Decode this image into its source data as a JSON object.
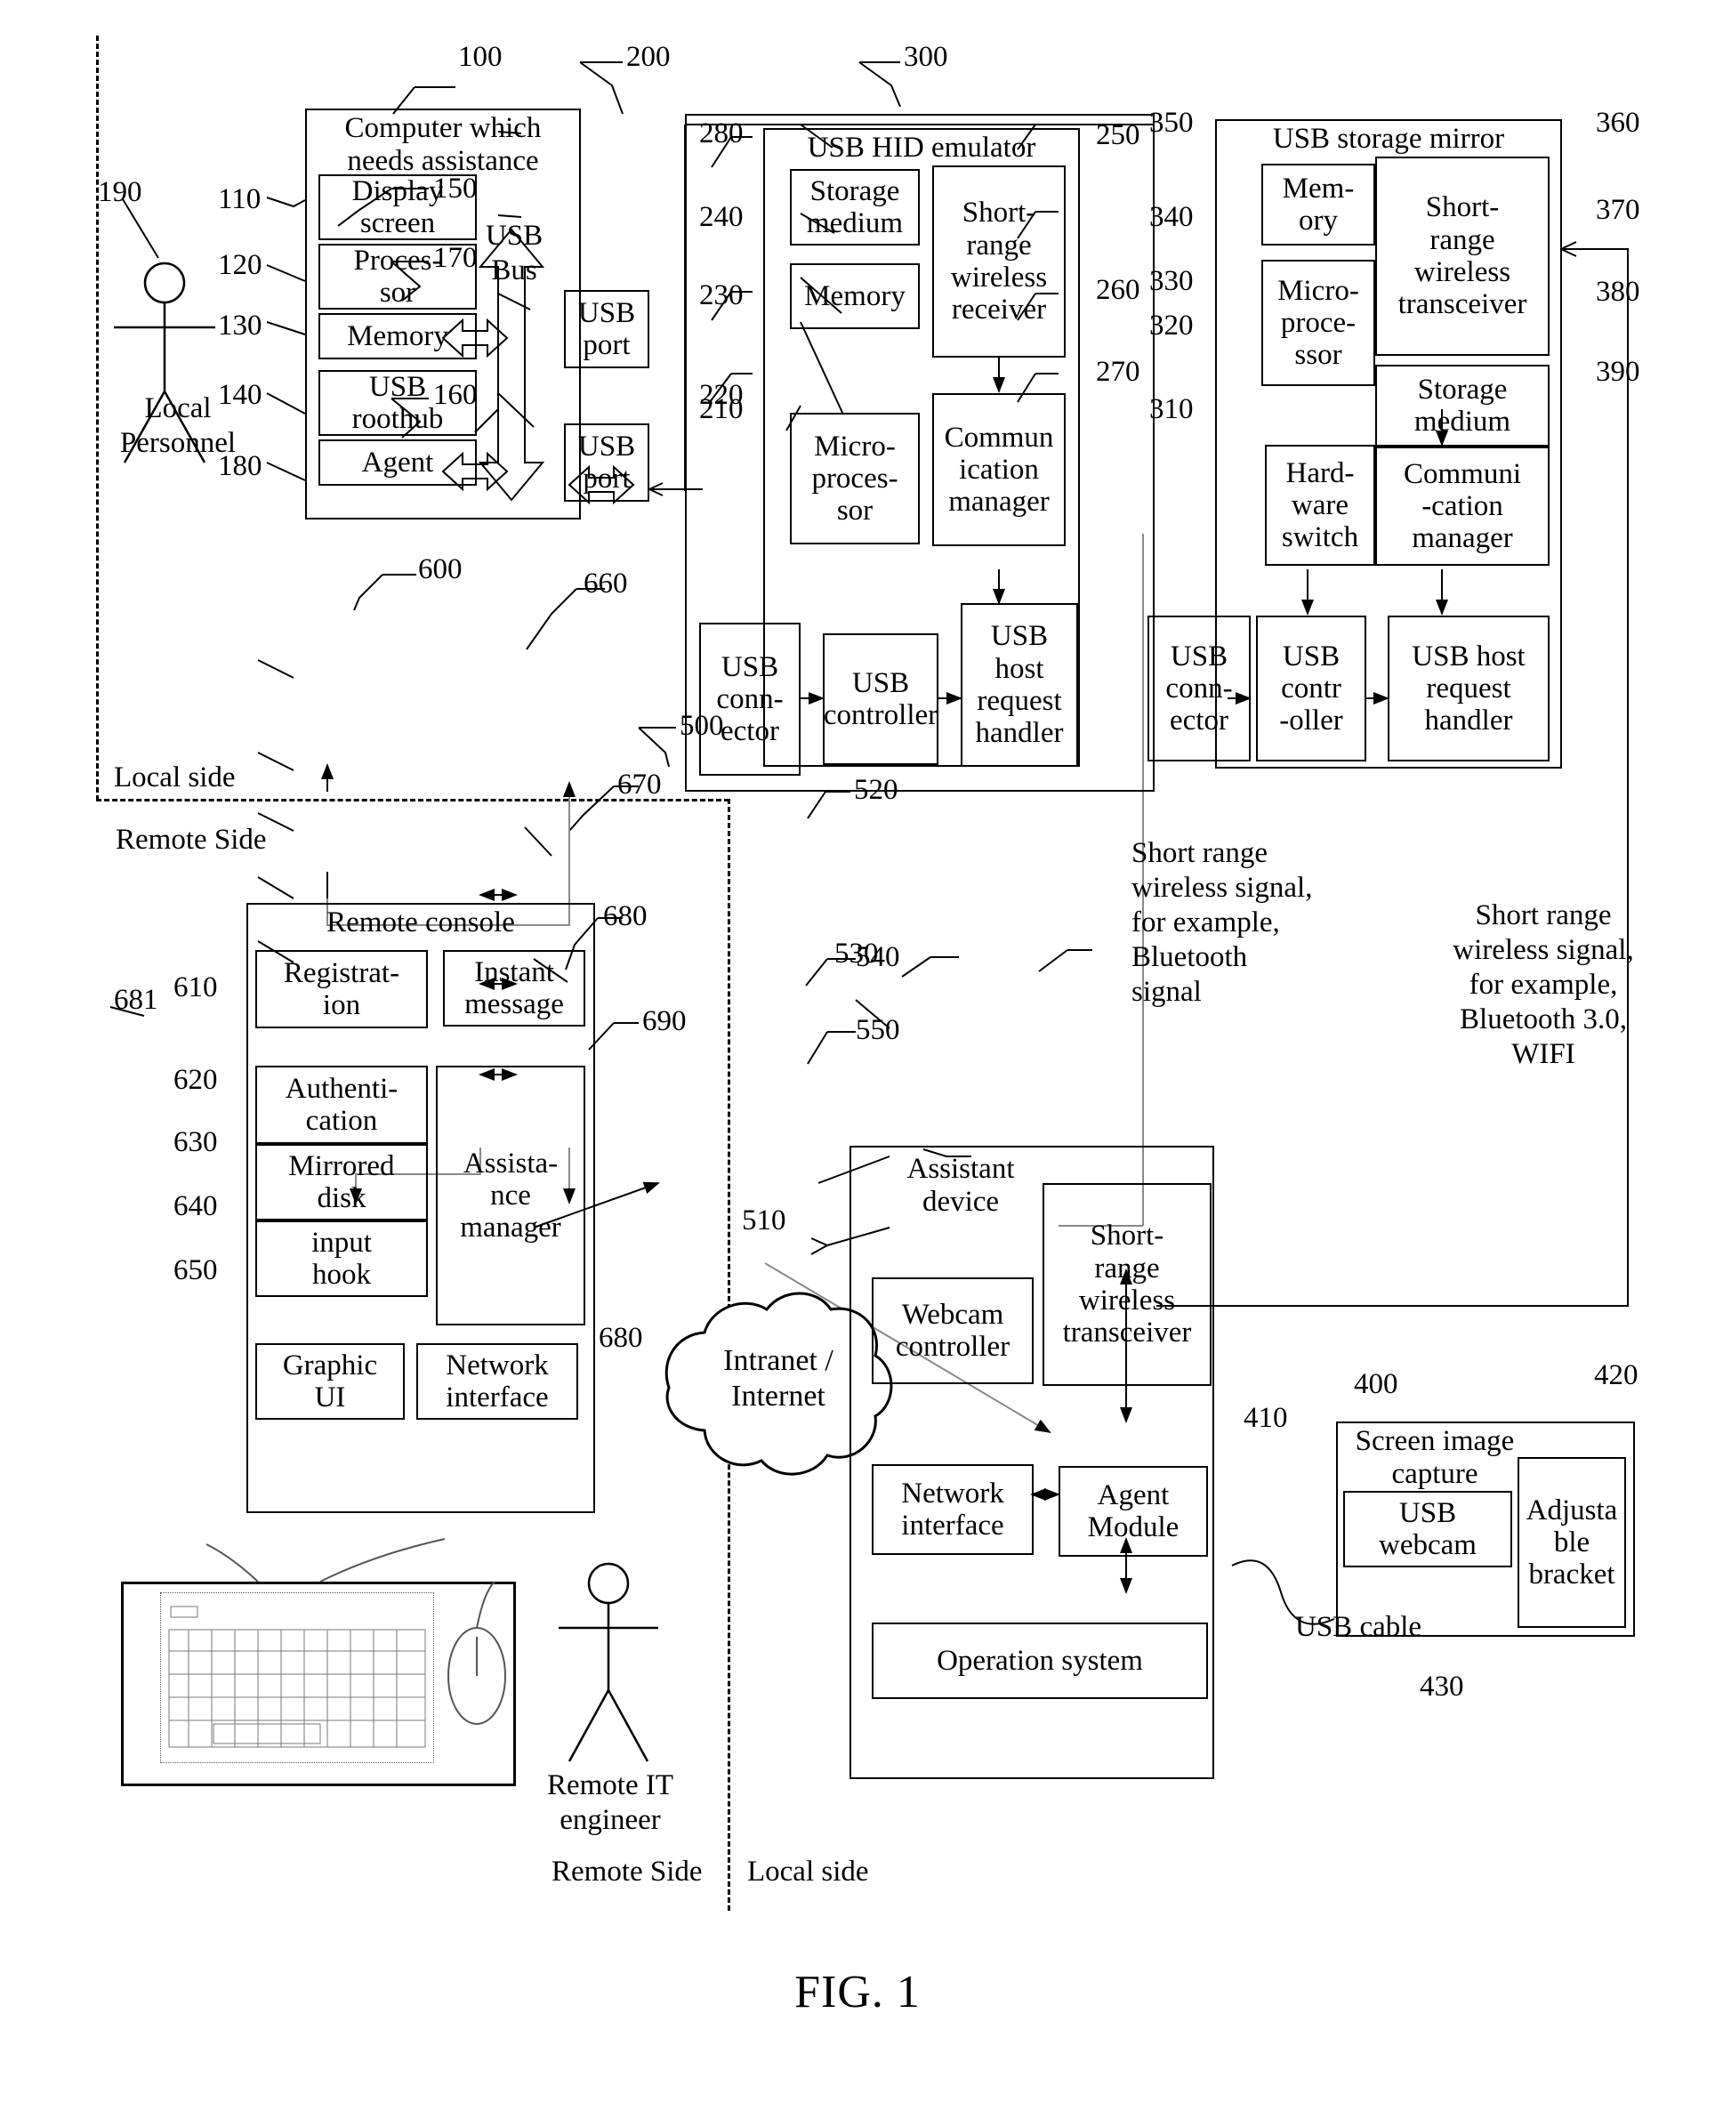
{
  "figure": {
    "caption": "FIG. 1"
  },
  "dividers": {
    "local_side_top": "Local side",
    "remote_side_top": "Remote Side",
    "remote_side_bottom": "Remote Side",
    "local_side_bottom": "Local side"
  },
  "actors": {
    "local_personnel": {
      "ref": "190",
      "label": "Local\nPersonnel"
    },
    "remote_it_engineer": {
      "ref": "690",
      "label": "Remote IT\nengineer"
    }
  },
  "computer": {
    "ref": "100",
    "title": "Computer which\nneeds assistance",
    "parts": [
      {
        "ref": "110",
        "label": "Display\nscreen"
      },
      {
        "ref": "120",
        "label": "Proces-\nsor"
      },
      {
        "ref": "130",
        "label": "Memory"
      },
      {
        "ref": "140",
        "label": "USB\nroothub"
      },
      {
        "ref": "180",
        "label": "Agent"
      }
    ],
    "bus": {
      "ref": "150",
      "label": "USB\nBus"
    },
    "ports": [
      {
        "ref": "170",
        "label": "USB\nport"
      },
      {
        "ref": "160",
        "label": "USB\nport"
      }
    ]
  },
  "hid_emulator": {
    "ref": "200",
    "title": "USB HID emulator",
    "parts": [
      {
        "ref": "280",
        "label": "Storage\nmedium"
      },
      {
        "ref": "240",
        "label": "Memory"
      },
      {
        "ref": "230",
        "label": "Micro-\nproces-\nsor"
      },
      {
        "ref": "220",
        "label": "USB\ncontroller"
      },
      {
        "ref": "210",
        "label": "USB\nconn-\nector"
      },
      {
        "ref": "250",
        "label": "Short-\nrange\nwireless\nreceiver"
      },
      {
        "ref": "260",
        "label": "Commun\nication\nmanager"
      },
      {
        "ref": "270",
        "label": "USB\nhost\nrequest\nhandler"
      }
    ]
  },
  "storage_mirror": {
    "ref": "300",
    "title": "USB storage mirror",
    "parts": [
      {
        "ref": "350",
        "label": "Mem-\nory"
      },
      {
        "ref": "340",
        "label": "Micro-\nproce-\nssor"
      },
      {
        "ref": "330",
        "label": "Hard-\nware\nswitch"
      },
      {
        "ref": "320",
        "label": "USB\ncontr\n-oller"
      },
      {
        "ref": "310",
        "label": "USB\nconn-\nector"
      },
      {
        "ref": "360",
        "label": "Short-\nrange\nwireless\ntransceiver"
      },
      {
        "ref": "370",
        "label": "Storage\nmedium"
      },
      {
        "ref": "380",
        "label": "Communi\n-cation\nmanager"
      },
      {
        "ref": "390",
        "label": "USB host\nrequest\nhandler"
      }
    ]
  },
  "remote_console": {
    "ref": "600",
    "title": "Remote console",
    "parts": [
      {
        "ref": "610",
        "label": "Registrat-\nion"
      },
      {
        "ref": "620",
        "label": "Authenti-\ncation"
      },
      {
        "ref": "630",
        "label": "Mirrored\ndisk"
      },
      {
        "ref": "640",
        "label": "input\nhook"
      },
      {
        "ref": "650",
        "label": "Graphic\nUI"
      },
      {
        "ref": "660",
        "label": "Instant\nmessage"
      },
      {
        "ref": "670",
        "label": "Assista-\nnce\nmanager"
      },
      {
        "ref": "680",
        "label": "Network\ninterface"
      }
    ],
    "peripherals_ref": "681"
  },
  "assistant_device": {
    "ref": "500",
    "title": "Assistant\ndevice",
    "parts": [
      {
        "ref": "510",
        "label": "Webcam\ncontroller"
      },
      {
        "ref": "520",
        "label": "Short-\nrange\nwireless\ntransceiver"
      },
      {
        "ref": "530",
        "label": "Network\ninterface"
      },
      {
        "ref": "540",
        "label": "Agent\nModule"
      },
      {
        "ref": "550",
        "label": "Operation system"
      }
    ]
  },
  "screen_capture": {
    "ref": "400",
    "title": "Screen image\ncapture",
    "parts": [
      {
        "ref": "410",
        "label": "USB\nwebcam"
      },
      {
        "ref": "420",
        "label": "Adjusta\nble\nbracket"
      }
    ],
    "cable": {
      "ref": "430",
      "label": "USB cable"
    }
  },
  "cloud": {
    "ref": "680",
    "label": "Intranet /\nInternet"
  },
  "annotations": {
    "bt_signal": "Short range\nwireless signal,\nfor example,\nBluetooth\nsignal",
    "bt30_wifi_signal": "Short range\nwireless signal,\nfor example,\nBluetooth 3.0,\nWIFI"
  }
}
